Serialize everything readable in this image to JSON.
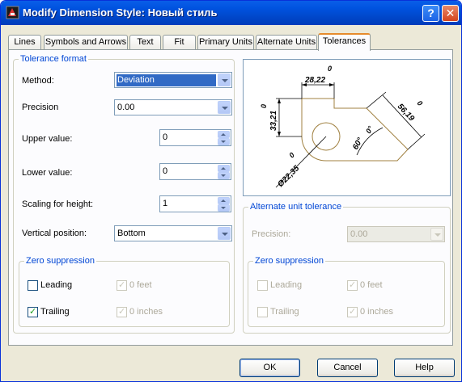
{
  "window": {
    "title": "Modify Dimension Style: Новый стиль",
    "help_button": "?",
    "close_button": "✕"
  },
  "tabs": [
    {
      "label": "Lines",
      "active": false
    },
    {
      "label": "Symbols and Arrows",
      "active": false
    },
    {
      "label": "Text",
      "active": false
    },
    {
      "label": "Fit",
      "active": false
    },
    {
      "label": "Primary Units",
      "active": false
    },
    {
      "label": "Alternate Units",
      "active": false
    },
    {
      "label": "Tolerances",
      "active": true
    }
  ],
  "tolerance_format": {
    "legend": "Tolerance format",
    "method_label": "Method:",
    "method_value": "Deviation",
    "precision_label": "Precision",
    "precision_value": "0.00",
    "upper_label": "Upper value:",
    "upper_value": "0",
    "lower_label": "Lower value:",
    "lower_value": "0",
    "scaling_label": "Scaling for height:",
    "scaling_value": "1",
    "vertical_label": "Vertical position:",
    "vertical_value": "Bottom"
  },
  "zero_suppression": {
    "legend": "Zero suppression",
    "leading_label": "Leading",
    "leading_checked": false,
    "trailing_label": "Trailing",
    "trailing_checked": true,
    "feet_label": "0 feet",
    "feet_checked": true,
    "inches_label": "0 inches",
    "inches_checked": true
  },
  "alternate_unit_tolerance": {
    "legend": "Alternate unit tolerance",
    "precision_label": "Precision:",
    "precision_value": "0.00",
    "zero_suppression": {
      "legend": "Zero suppression",
      "leading_label": "Leading",
      "leading_checked": false,
      "trailing_label": "Trailing",
      "trailing_checked": false,
      "feet_label": "0 feet",
      "feet_checked": true,
      "inches_label": "0 inches",
      "inches_checked": true
    }
  },
  "preview": {
    "dim_top": "28,22",
    "dim_top_tol": "0",
    "dim_left": "33,21",
    "dim_left_tol": "0",
    "dim_right": "56,19",
    "dim_right_tol": "0",
    "dim_diameter": "Ø22,35",
    "dim_diameter_tol": "0",
    "dim_angle": "60°",
    "dim_angle_tol": "0°"
  },
  "buttons": {
    "ok": "OK",
    "cancel": "Cancel",
    "help": "Help"
  }
}
